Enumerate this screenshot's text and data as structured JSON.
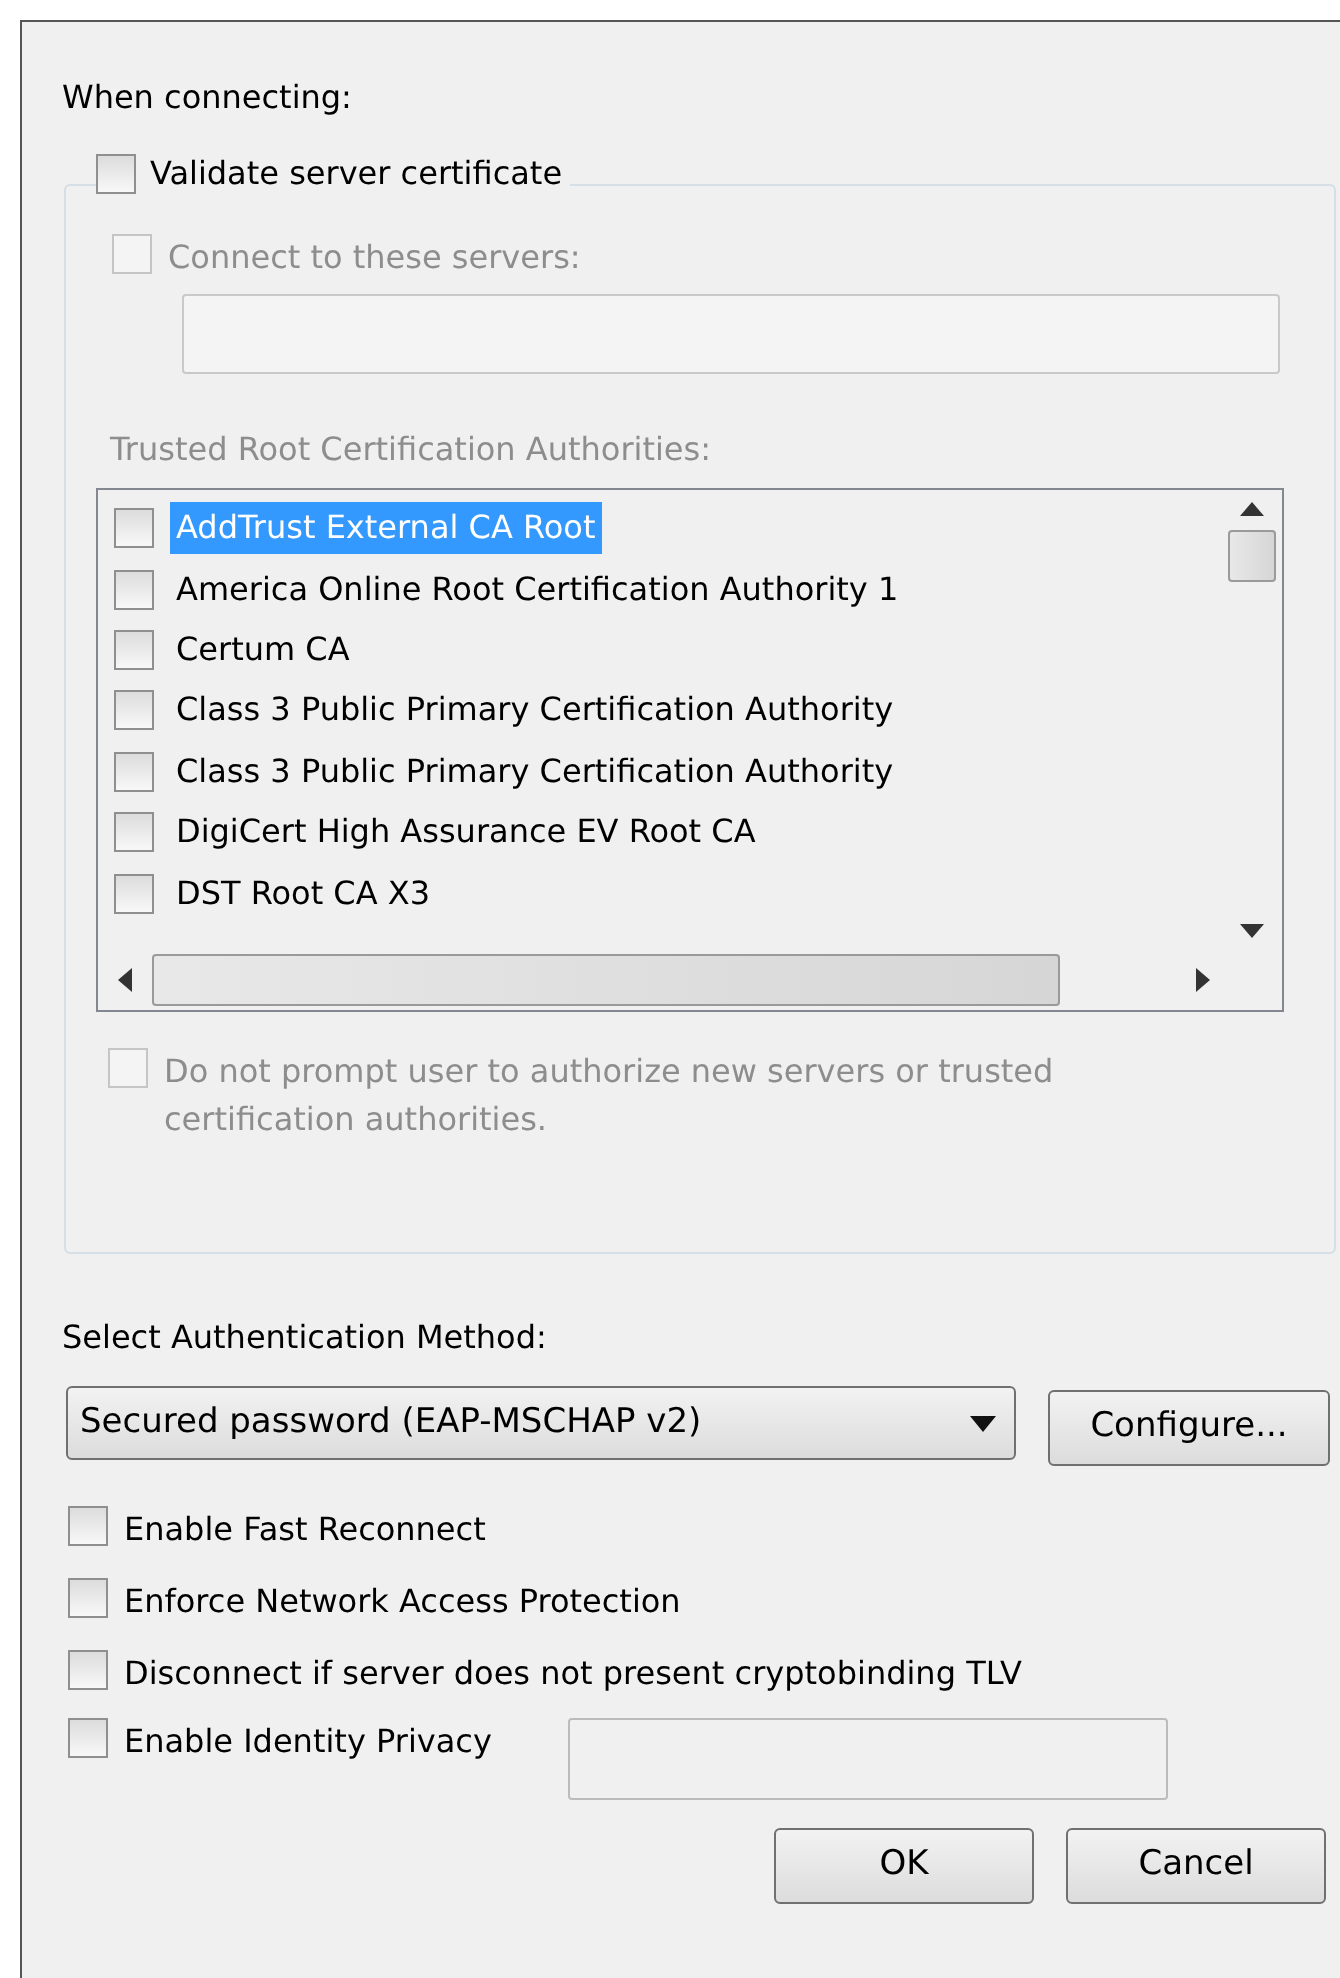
{
  "heading": "When connecting:",
  "validate": {
    "label": "Validate server certificate",
    "checked": false
  },
  "connect": {
    "label": "Connect to these servers:",
    "checked": false,
    "disabled": true
  },
  "trusted_label": "Trusted Root Certification Authorities:",
  "authorities": [
    {
      "label": "AddTrust External CA Root",
      "checked": false,
      "selected": true
    },
    {
      "label": "America Online Root Certification Authority 1",
      "checked": false,
      "selected": false
    },
    {
      "label": "Certum CA",
      "checked": false,
      "selected": false
    },
    {
      "label": "Class 3 Public Primary Certification Authority",
      "checked": false,
      "selected": false
    },
    {
      "label": "Class 3 Public Primary Certification Authority",
      "checked": false,
      "selected": false
    },
    {
      "label": "DigiCert High Assurance EV Root CA",
      "checked": false,
      "selected": false
    },
    {
      "label": "DST Root CA X3",
      "checked": false,
      "selected": false
    }
  ],
  "no_prompt": {
    "label": "Do not prompt user to authorize new servers or trusted certification authorities.",
    "checked": false,
    "disabled": true
  },
  "auth_label": "Select Authentication Method:",
  "auth_method": "Secured password (EAP-MSCHAP v2)",
  "configure": "Configure...",
  "options": [
    {
      "label": "Enable Fast Reconnect",
      "checked": false
    },
    {
      "label": "Enforce Network Access Protection",
      "checked": false
    },
    {
      "label": "Disconnect if server does not present cryptobinding TLV",
      "checked": false
    },
    {
      "label": "Enable Identity Privacy",
      "checked": false,
      "kind": "field"
    }
  ],
  "buttons": [
    "OK",
    "Cancel"
  ]
}
